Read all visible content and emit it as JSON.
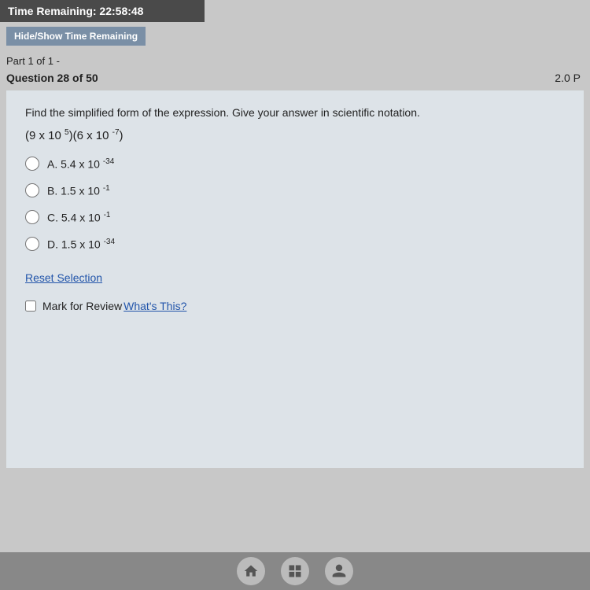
{
  "timer": {
    "label": "Time Remaining: 22:58:48",
    "hide_show_label": "Hide/Show Time Remaining"
  },
  "part": {
    "label": "Part 1 of 1 -"
  },
  "question": {
    "number_label": "Question 28 of 50",
    "points_label": "2.0 P",
    "text": "Find the simplified form of the expression. Give your answer in scientific notation.",
    "expression_parts": {
      "full": "(9 x 10 5)(6 x 10 -7)"
    },
    "options": [
      {
        "id": "A",
        "label": "A. 5.4 x 10",
        "sup": "-34"
      },
      {
        "id": "B",
        "label": "B. 1.5 x 10",
        "sup": "-1"
      },
      {
        "id": "C",
        "label": "C. 5.4 x 10",
        "sup": "-1"
      },
      {
        "id": "D",
        "label": "D. 1.5 x 10",
        "sup": "-34"
      }
    ]
  },
  "reset_label": "Reset Selection",
  "mark_review": {
    "label": "Mark for Review",
    "whats_this": "What's This?"
  }
}
